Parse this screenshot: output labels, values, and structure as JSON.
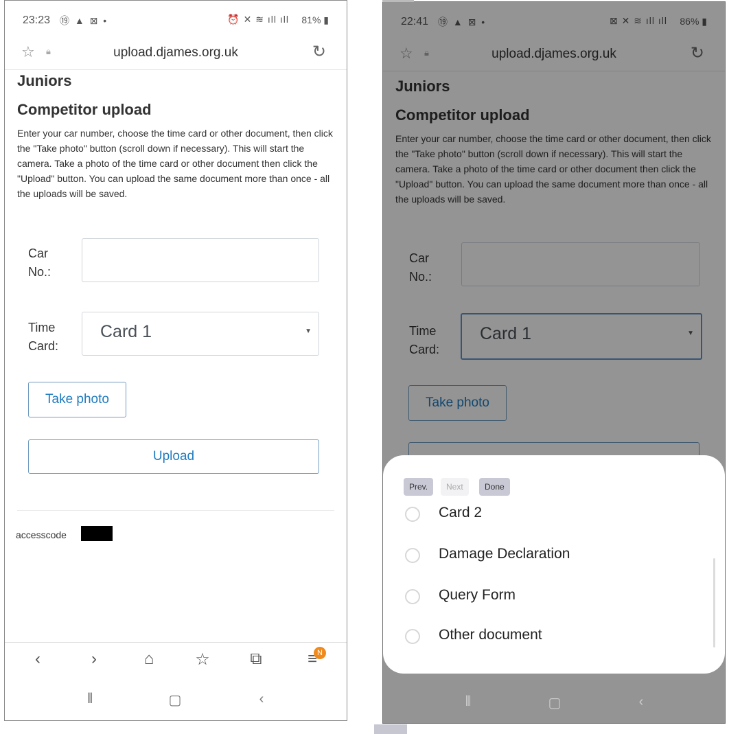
{
  "left": {
    "status": {
      "time": "23:23",
      "icons_left": "⑲ ▲ ⊠ •",
      "icons_right": "⏰ ✕ ≋ ıll ıll",
      "battery": "81%"
    },
    "browser": {
      "url": "upload.djames.org.uk"
    },
    "page": {
      "heading1": "Juniors",
      "heading2": "Competitor upload",
      "intro": "Enter your car number, choose the time card or other document, then click the \"Take photo\" button (scroll down if necessary). This will start the camera. Take a photo of the time card or other document then click the \"Upload\" button. You can upload the same document more than once - all the uploads will be saved.",
      "car_label": "Car\nNo.:",
      "car_value": "",
      "time_card_label": "Time\nCard:",
      "time_card_value": "Card 1",
      "take_photo": "Take photo",
      "upload": "Upload",
      "access_label": "accesscode"
    },
    "nav": {
      "badge": "N"
    }
  },
  "right": {
    "status": {
      "time": "22:41",
      "icons_left": "⑲ ▲ ⊠ •",
      "icons_right": "⊠ ✕ ≋ ıll ıll",
      "battery": "86%"
    },
    "browser": {
      "url": "upload.djames.org.uk"
    },
    "page": {
      "heading1": "Juniors",
      "heading2": "Competitor upload",
      "intro": "Enter your car number, choose the time card or other document, then click the \"Take photo\" button (scroll down if necessary). This will start the camera. Take a photo of the time card or other document then click the \"Upload\" button. You can upload the same document more than once - all the uploads will be saved.",
      "car_label": "Car\nNo.:",
      "time_card_label": "Time\nCard:",
      "time_card_value": "Card 1",
      "take_photo": "Take photo"
    },
    "picker": {
      "prev": "Prev.",
      "next": "Next",
      "done": "Done",
      "options": [
        "Card 2",
        "Damage Declaration",
        "Query Form",
        "Other document"
      ]
    }
  }
}
